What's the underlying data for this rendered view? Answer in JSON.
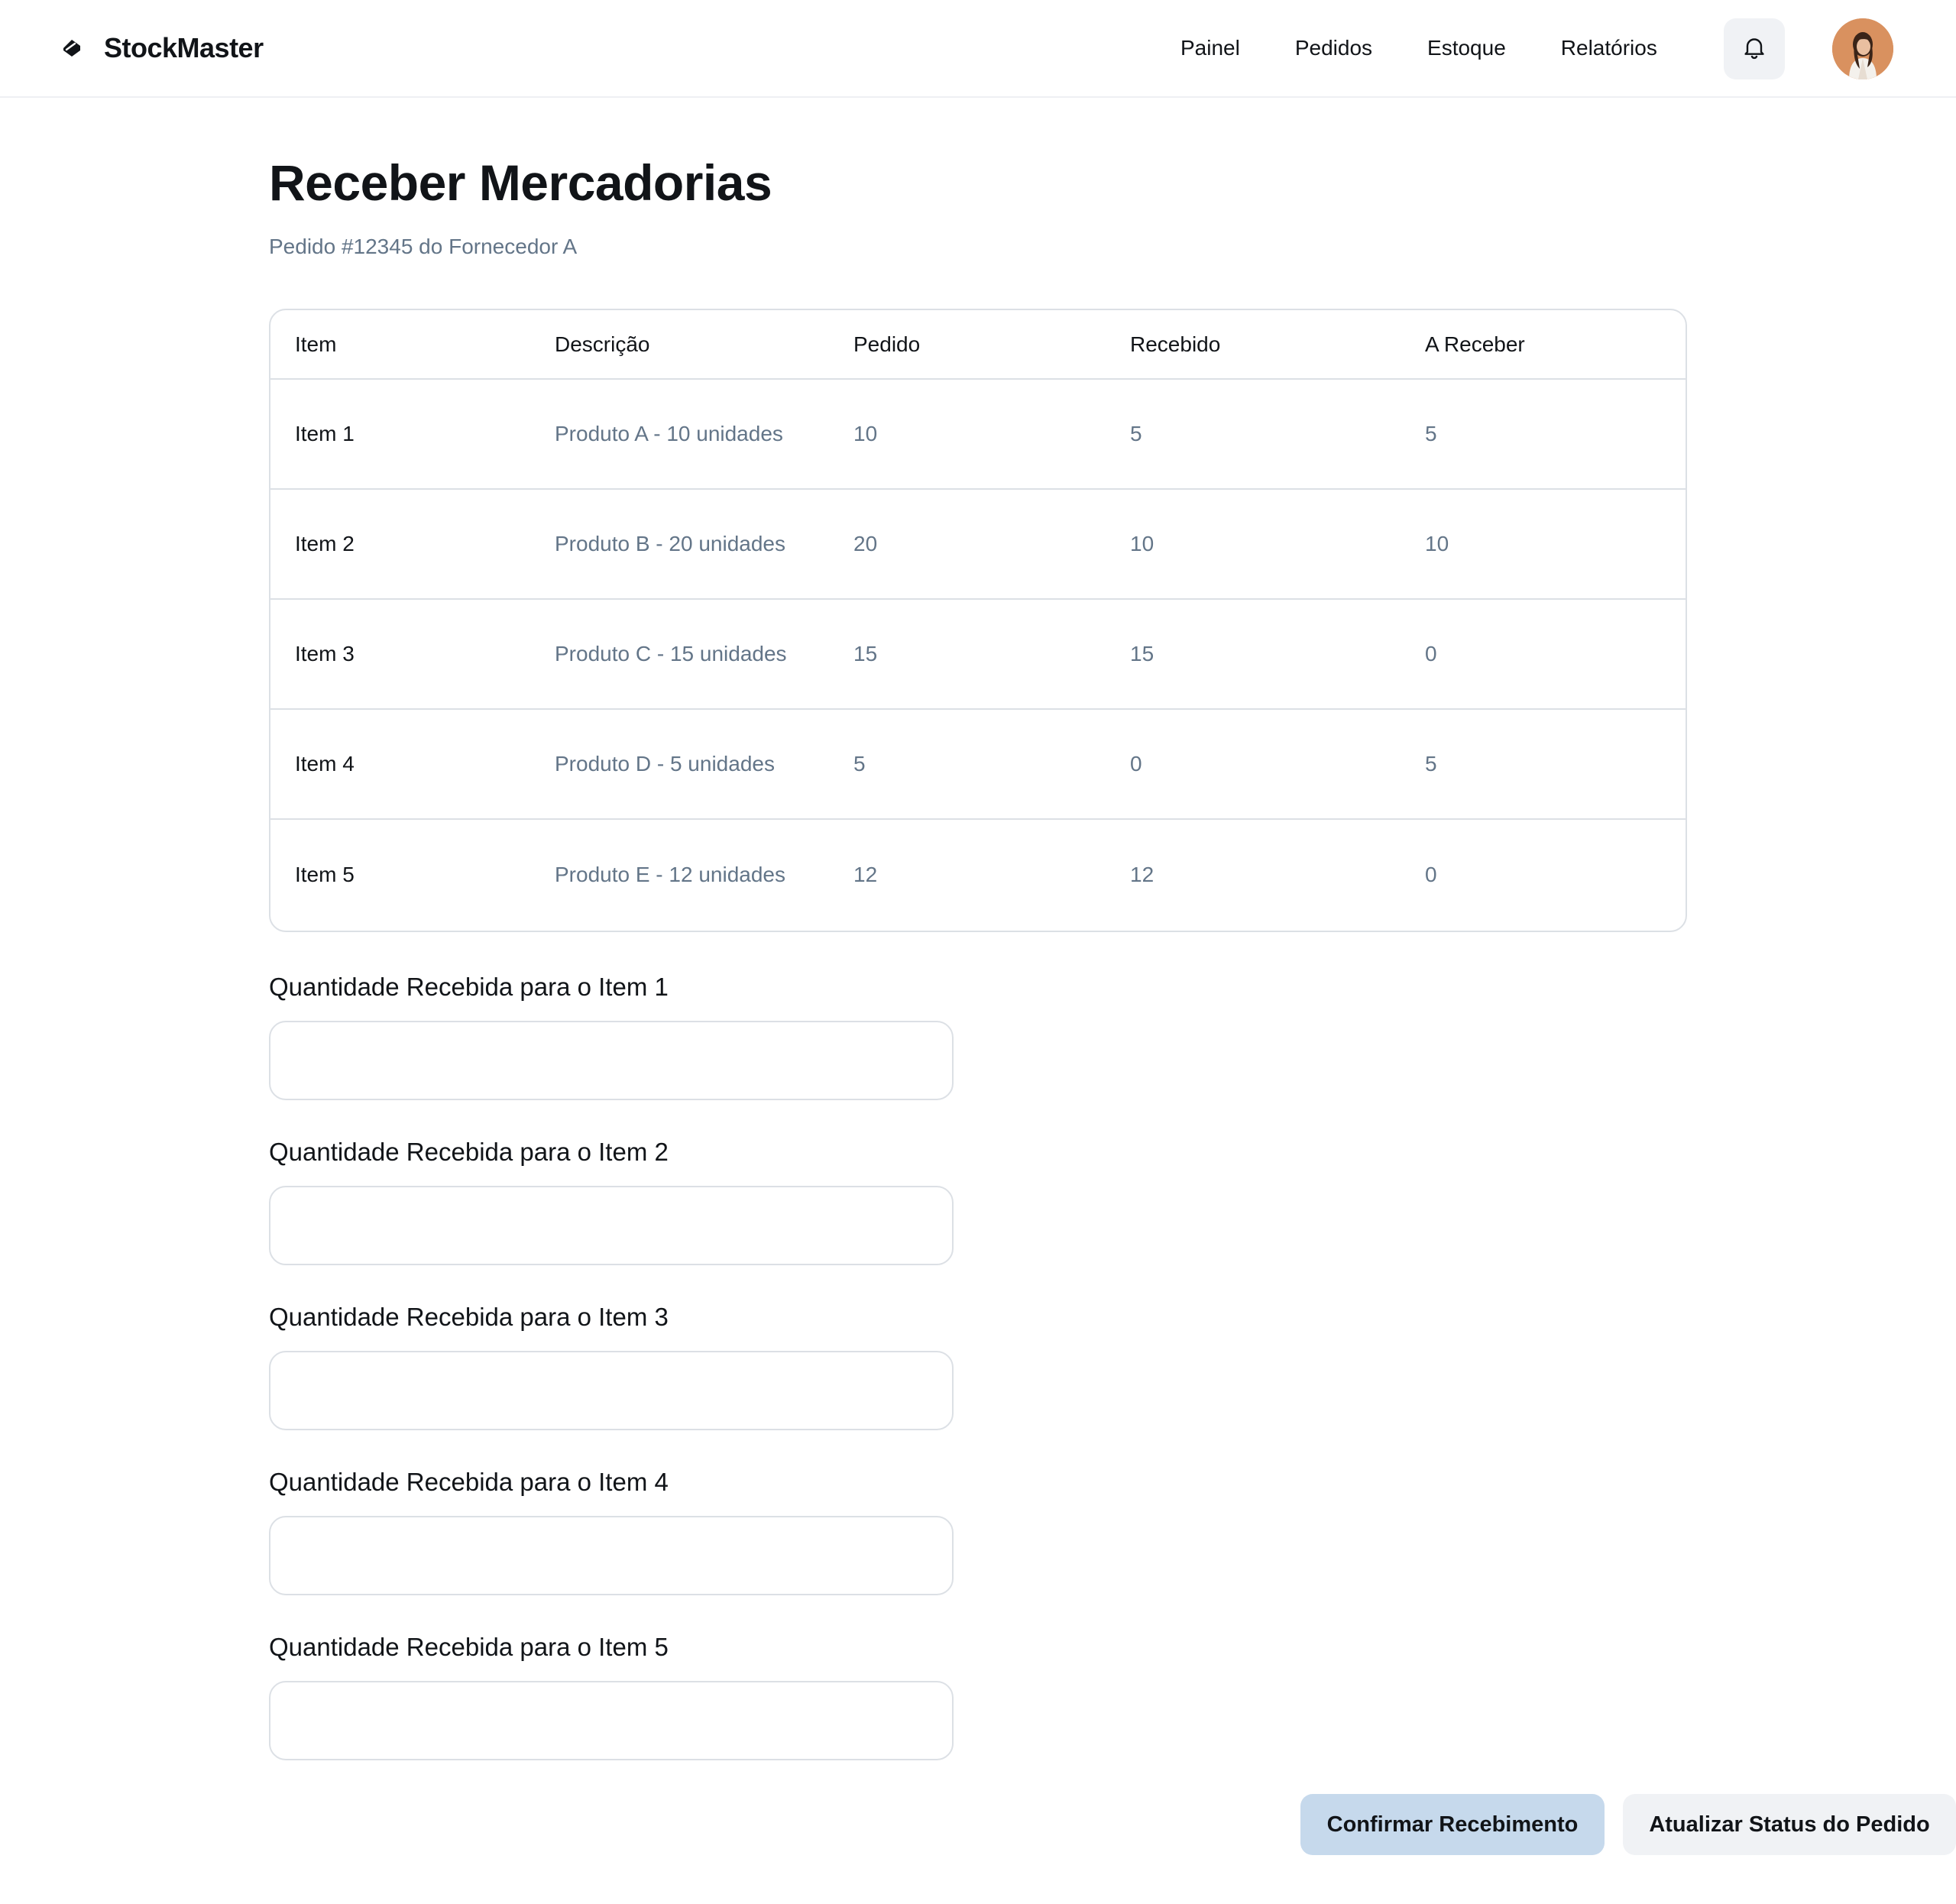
{
  "header": {
    "brand": "StockMaster",
    "nav": [
      "Painel",
      "Pedidos",
      "Estoque",
      "Relatórios"
    ]
  },
  "page": {
    "title": "Receber Mercadorias",
    "subtitle": "Pedido #12345 do Fornecedor A"
  },
  "table": {
    "columns": [
      "Item",
      "Descrição",
      "Pedido",
      "Recebido",
      "A Receber"
    ],
    "rows": [
      [
        "Item 1",
        "Produto A - 10 unidades",
        "10",
        "5",
        "5"
      ],
      [
        "Item 2",
        "Produto B - 20 unidades",
        "20",
        "10",
        "10"
      ],
      [
        "Item 3",
        "Produto C - 15 unidades",
        "15",
        "15",
        "0"
      ],
      [
        "Item 4",
        "Produto D - 5 unidades",
        "5",
        "0",
        "5"
      ],
      [
        "Item 5",
        "Produto E - 12 unidades",
        "12",
        "12",
        "0"
      ]
    ]
  },
  "form": {
    "fields": [
      {
        "label": "Quantidade Recebida para o Item 1",
        "value": ""
      },
      {
        "label": "Quantidade Recebida para o Item 2",
        "value": ""
      },
      {
        "label": "Quantidade Recebida para o Item 3",
        "value": ""
      },
      {
        "label": "Quantidade Recebida para o Item 4",
        "value": ""
      },
      {
        "label": "Quantidade Recebida para o Item 5",
        "value": ""
      }
    ]
  },
  "actions": {
    "confirm": "Confirmar Recebimento",
    "update": "Atualizar Status do Pedido"
  },
  "colors": {
    "primary_button": "#c6d9ec",
    "secondary_button": "#f0f2f5",
    "muted_text": "#637588",
    "border": "#dce0e5"
  },
  "icons": {
    "brand": "tag-icon",
    "notifications": "bell-icon",
    "avatar": "user-avatar"
  }
}
